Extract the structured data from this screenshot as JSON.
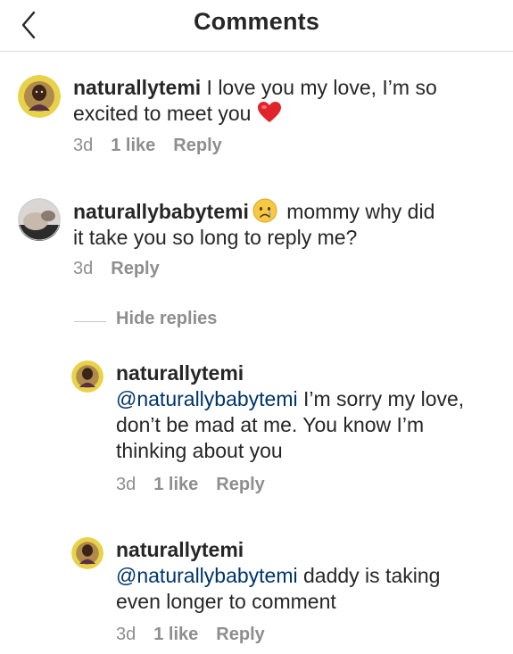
{
  "header": {
    "title": "Comments",
    "back_icon": "chevron-left-icon"
  },
  "comments": [
    {
      "username": "naturallytemi",
      "text_before_emoji": " I love you my love, I’m so excited to meet you ",
      "emoji": "red-heart-icon",
      "time": "3d",
      "likes": "1 like",
      "reply": "Reply"
    },
    {
      "username": "naturallybabytemi",
      "emoji": "crying-face-icon",
      "text_after_emoji": " mommy why did it take you so long to reply me?",
      "time": "3d",
      "reply": "Reply"
    }
  ],
  "hide_replies": "Hide replies",
  "replies": [
    {
      "username": "naturallytemi",
      "mention": "@naturallybabytemi",
      "text": " I’m sorry my love, don’t be mad at me. You know I’m thinking about you",
      "time": "3d",
      "likes": "1 like",
      "reply": "Reply"
    },
    {
      "username": "naturallytemi",
      "mention": "@naturallybabytemi",
      "text": " daddy is taking even longer to comment",
      "time": "3d",
      "likes": "1 like",
      "reply": "Reply"
    }
  ],
  "colors": {
    "text": "#262626",
    "meta": "#8e8e8e",
    "mention": "#003569",
    "avatar_ring": "#e8d24a",
    "heart": "#e0242a"
  }
}
